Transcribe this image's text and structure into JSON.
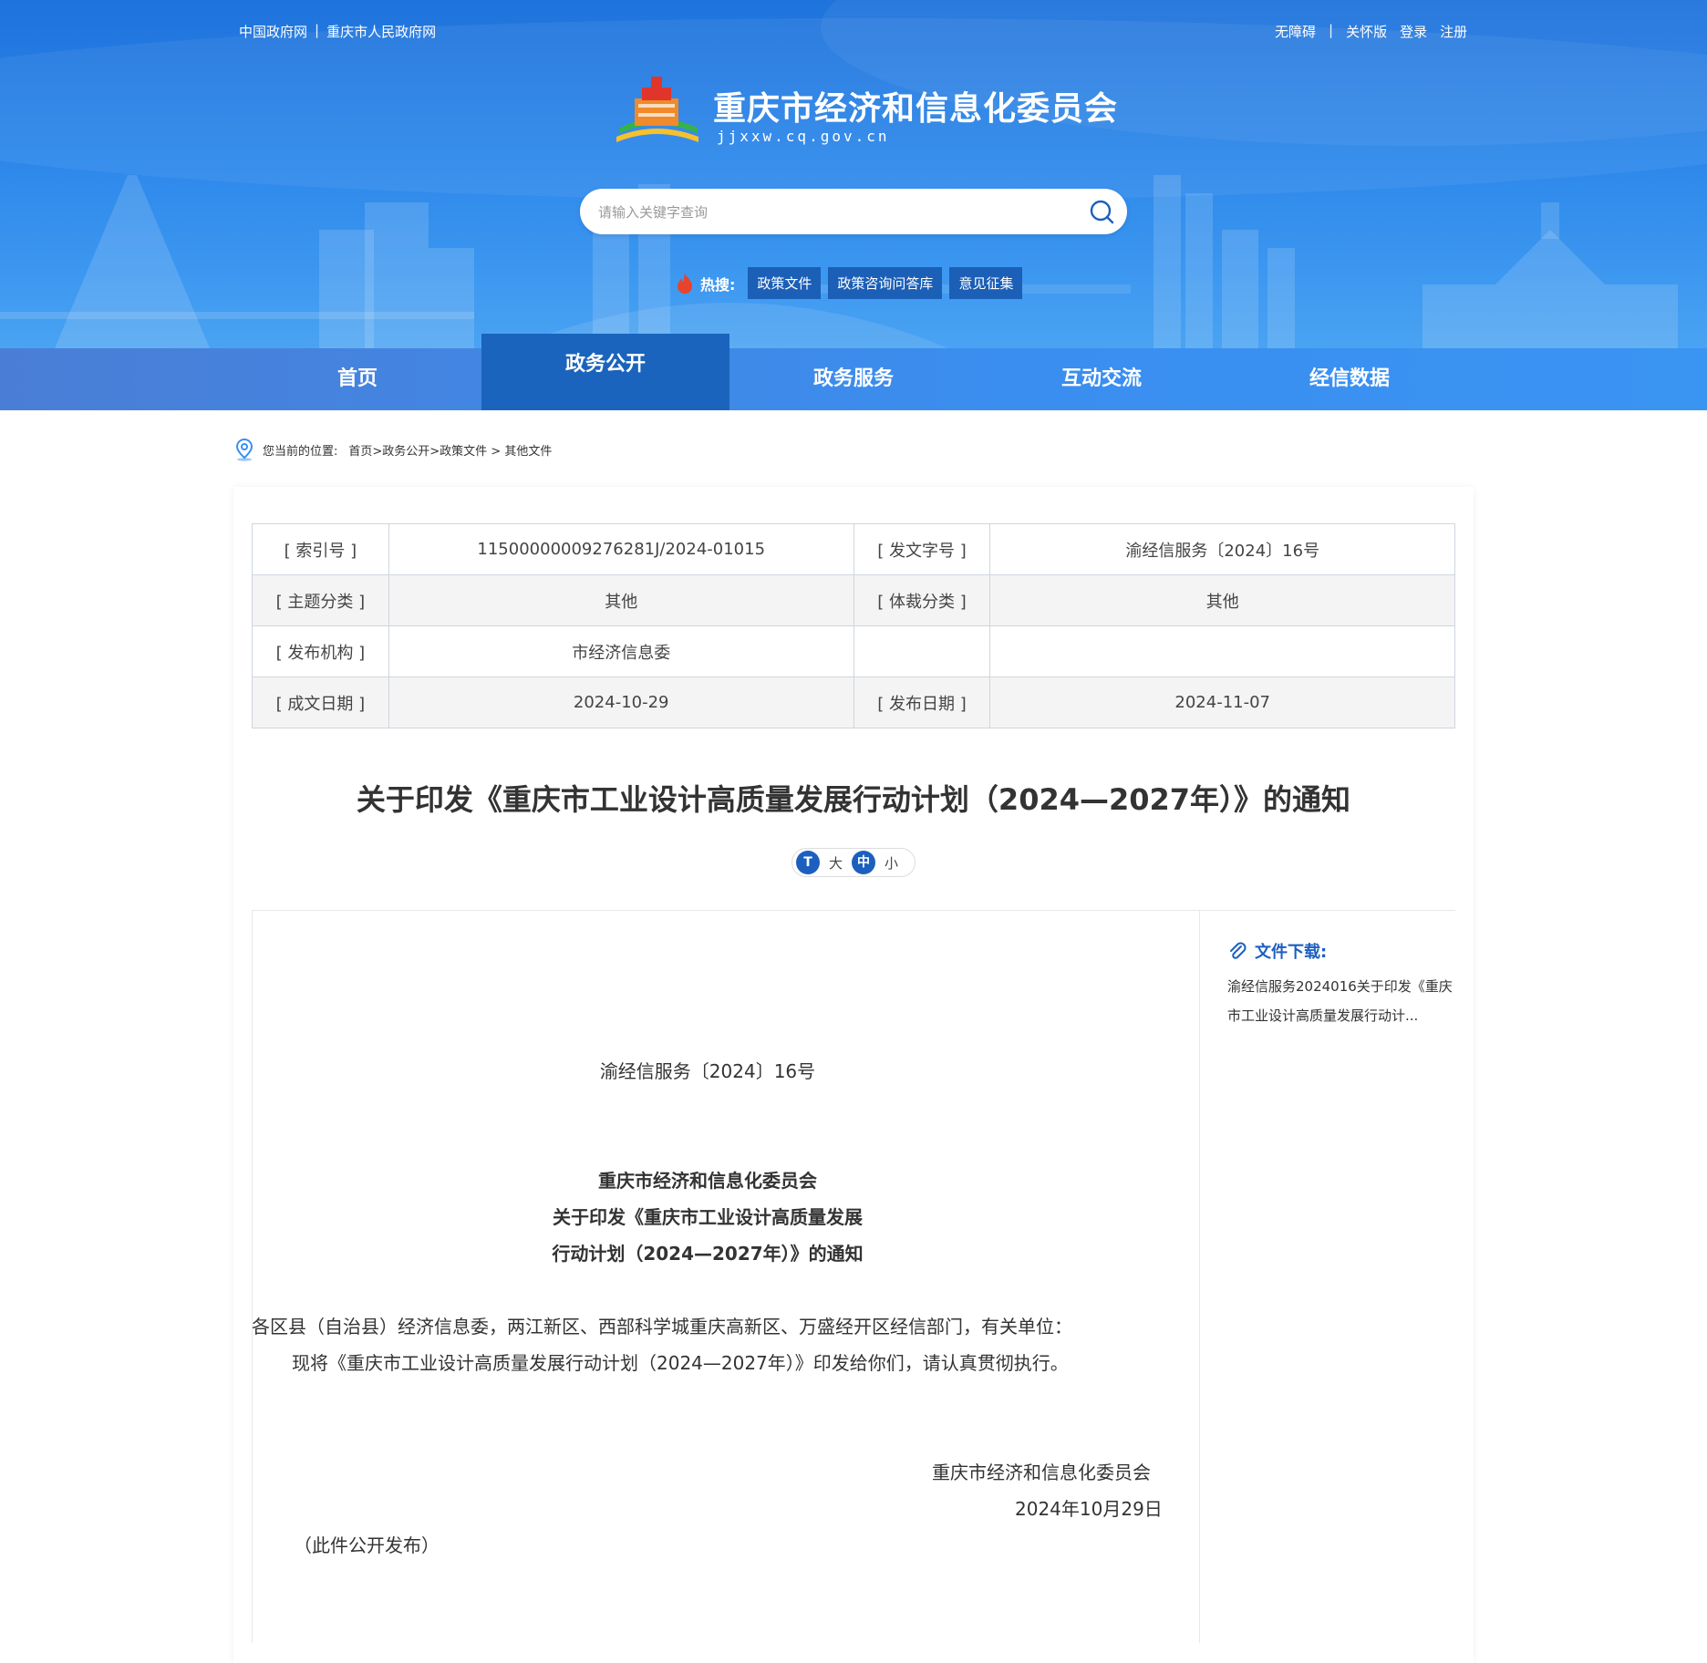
{
  "top_links_left": [
    "中国政府网",
    "|",
    "重庆市人民政府网"
  ],
  "top_links_right": [
    "无障碍",
    "|",
    "关怀版",
    "登录",
    "注册"
  ],
  "site": {
    "title": "重庆市经济和信息化委员会",
    "domain": "jjxxw.cq.gov.cn"
  },
  "search": {
    "placeholder": "请输入关键字查询"
  },
  "hot": {
    "label": "热搜:",
    "tags": [
      "政策文件",
      "政策咨询问答库",
      "意见征集"
    ]
  },
  "nav": [
    "首页",
    "政务公开",
    "政务服务",
    "互动交流",
    "经信数据"
  ],
  "breadcrumb": {
    "prefix": "您当前的位置:",
    "path": "首页>政务公开>政策文件 > 其他文件"
  },
  "meta": {
    "rows": [
      [
        "[ 索引号 ]",
        "11500000009276281J/2024-01015",
        "[ 发文字号 ]",
        "渝经信服务〔2024〕16号"
      ],
      [
        "[ 主题分类 ]",
        "其他",
        "[ 体裁分类 ]",
        "其他"
      ],
      [
        "[ 发布机构 ]",
        "市经济信息委",
        "",
        ""
      ],
      [
        "[ 成文日期 ]",
        "2024-10-29",
        "[ 发布日期 ]",
        "2024-11-07"
      ]
    ]
  },
  "doc": {
    "title": "关于印发《重庆市工业设计高质量发展行动计划（2024—2027年）》的通知",
    "font_controls": {
      "icon": "T",
      "big": "大",
      "mid": "中",
      "small": "小"
    },
    "number": "渝经信服务〔2024〕16号",
    "head1": "重庆市经济和信息化委员会",
    "head2": "关于印发《重庆市工业设计高质量发展",
    "head3": "行动计划（2024—2027年）》的通知",
    "addressee": "各区县（自治县）经济信息委，两江新区、西部科学城重庆高新区、万盛经开区经信部门，有关单位：",
    "body": "现将《重庆市工业设计高质量发展行动计划（2024—2027年）》印发给你们，请认真贯彻执行。",
    "sign": "重庆市经济和信息化委员会",
    "date": "2024年10月29日",
    "note": "（此件公开发布）"
  },
  "sidebar": {
    "title": "文件下载:",
    "link": "渝经信服务2024016关于印发《重庆市工业设计高质量发展行动计..."
  },
  "colors": {
    "header": "#2c87ea",
    "nav_active": "#1a64bd",
    "accent": "#1c5fbf"
  }
}
